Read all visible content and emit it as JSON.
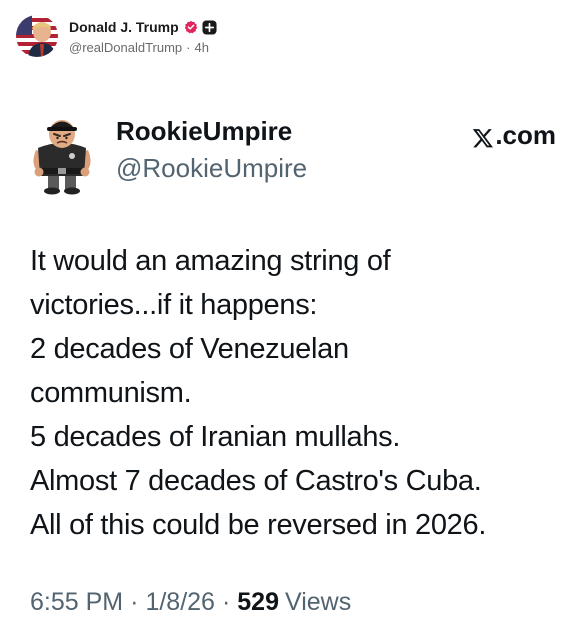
{
  "post": {
    "author_name": "Donald J. Trump",
    "author_handle": "@realDonaldTrump",
    "separator": "·",
    "age": "4h",
    "verified_color": "#e0245e"
  },
  "embed": {
    "name": "RookieUmpire",
    "handle": "@RookieUmpire",
    "source": ".com",
    "text_lines": [
      "It would an amazing string of",
      "victories...if it happens:",
      "2 decades of Venezuelan",
      "communism.",
      "5 decades of Iranian mullahs.",
      "Almost 7 decades of Castro's Cuba.",
      "All of this could be reversed in 2026."
    ],
    "time": "6:55 PM",
    "separator": "·",
    "date": "1/8/26",
    "views_count": "529",
    "views_label": "Views"
  },
  "icons": {
    "verified": "verified-badge-icon",
    "follow": "plus-icon",
    "x_logo": "x-logo-icon"
  }
}
